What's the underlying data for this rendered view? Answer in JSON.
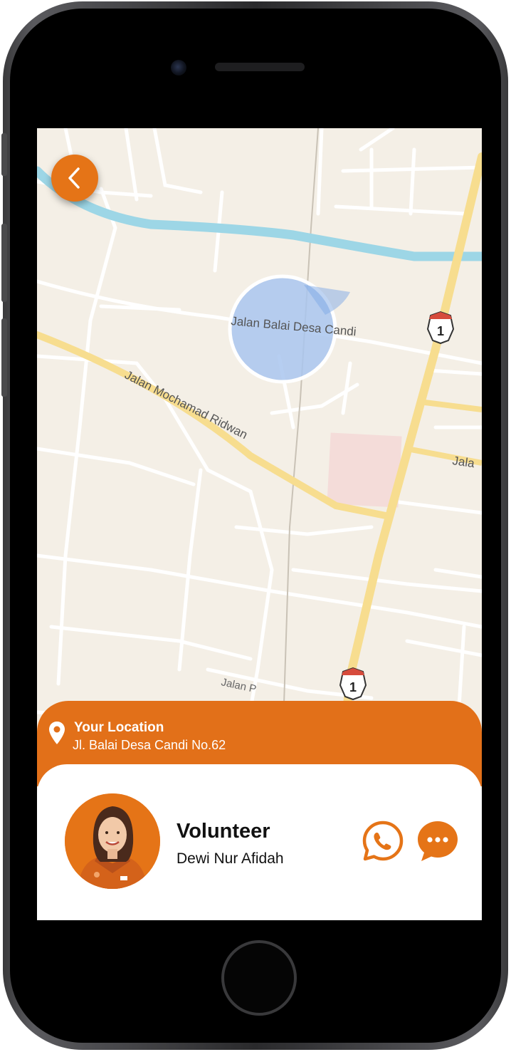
{
  "colors": {
    "accent": "#e57417",
    "map_background": "#f4efe6",
    "water": "#9dd6e6",
    "major_road": "#f7dd8f",
    "location_circle": "#a9c6ee"
  },
  "map": {
    "street_labels": [
      "Jalan Balai Desa Candi",
      "Jalan Mochamad Ridwan",
      "Jala",
      "Jalan P"
    ],
    "route_shields": [
      "1",
      "1"
    ]
  },
  "back_button": {
    "icon": "chevron-left-icon"
  },
  "location": {
    "title": "Your Location",
    "address": "Jl. Balai Desa Candi No.62",
    "icon": "map-pin-icon"
  },
  "volunteer": {
    "role": "Volunteer",
    "name": "Dewi Nur Afidah",
    "avatar_icon": "volunteer-avatar"
  },
  "actions": {
    "whatsapp_icon": "whatsapp-icon",
    "chat_icon": "chat-bubble-icon"
  }
}
